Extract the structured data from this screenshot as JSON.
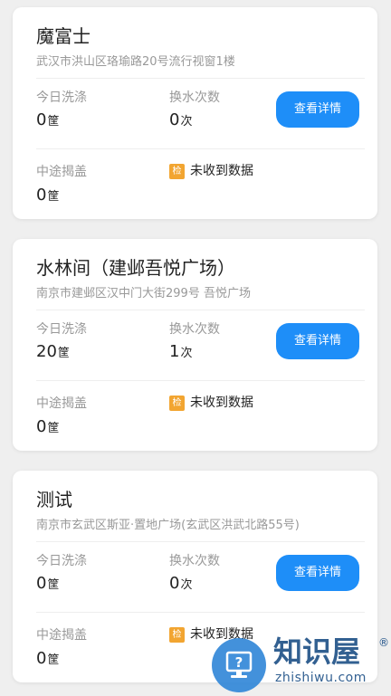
{
  "stores": [
    {
      "name": "魔富士",
      "address": "武汉市洪山区珞瑜路20号流行视窗1楼",
      "wash_label": "今日洗涤",
      "wash_value": "0",
      "wash_unit": "筐",
      "swap_label": "换水次数",
      "swap_value": "0",
      "swap_unit": "次",
      "detail_button": "查看详情",
      "mid_label": "中途揭盖",
      "mid_value": "0",
      "mid_unit": "筐",
      "status_badge": "检",
      "status_text": "未收到数据"
    },
    {
      "name": "水林间（建邺吾悦广场）",
      "address": "南京市建邺区汉中门大街299号 吾悦广场",
      "wash_label": "今日洗涤",
      "wash_value": "20",
      "wash_unit": "筐",
      "swap_label": "换水次数",
      "swap_value": "1",
      "swap_unit": "次",
      "detail_button": "查看详情",
      "mid_label": "中途揭盖",
      "mid_value": "0",
      "mid_unit": "筐",
      "status_badge": "检",
      "status_text": "未收到数据"
    },
    {
      "name": "测试",
      "address": "南京市玄武区斯亚·置地广场(玄武区洪武北路55号)",
      "wash_label": "今日洗涤",
      "wash_value": "0",
      "wash_unit": "筐",
      "swap_label": "换水次数",
      "swap_value": "0",
      "swap_unit": "次",
      "detail_button": "查看详情",
      "mid_label": "中途揭盖",
      "mid_value": "0",
      "mid_unit": "筐",
      "status_badge": "检",
      "status_text": "未收到数据"
    }
  ],
  "watermark": {
    "title": "知识屋",
    "reg": "®",
    "url": "zhishiwu.com"
  },
  "colors": {
    "accent": "#1e8ef8",
    "badge": "#f2a531",
    "muted_text": "#999999",
    "background": "#efefef"
  }
}
